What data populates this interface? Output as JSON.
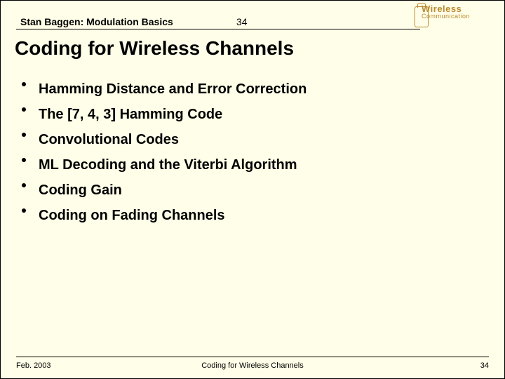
{
  "header": {
    "author_title": "Stan Baggen: Modulation Basics",
    "slide_number": "34"
  },
  "logo": {
    "line1": "Wireless",
    "line2": "Communication"
  },
  "title": "Coding for Wireless Channels",
  "bullets": [
    "Hamming Distance and Error Correction",
    "The [7, 4, 3] Hamming Code",
    "Convolutional Codes",
    "ML Decoding and the Viterbi Algorithm",
    "Coding Gain",
    "Coding on Fading Channels"
  ],
  "footer": {
    "date": "Feb. 2003",
    "center": "Coding for Wireless Channels",
    "page": "34"
  }
}
